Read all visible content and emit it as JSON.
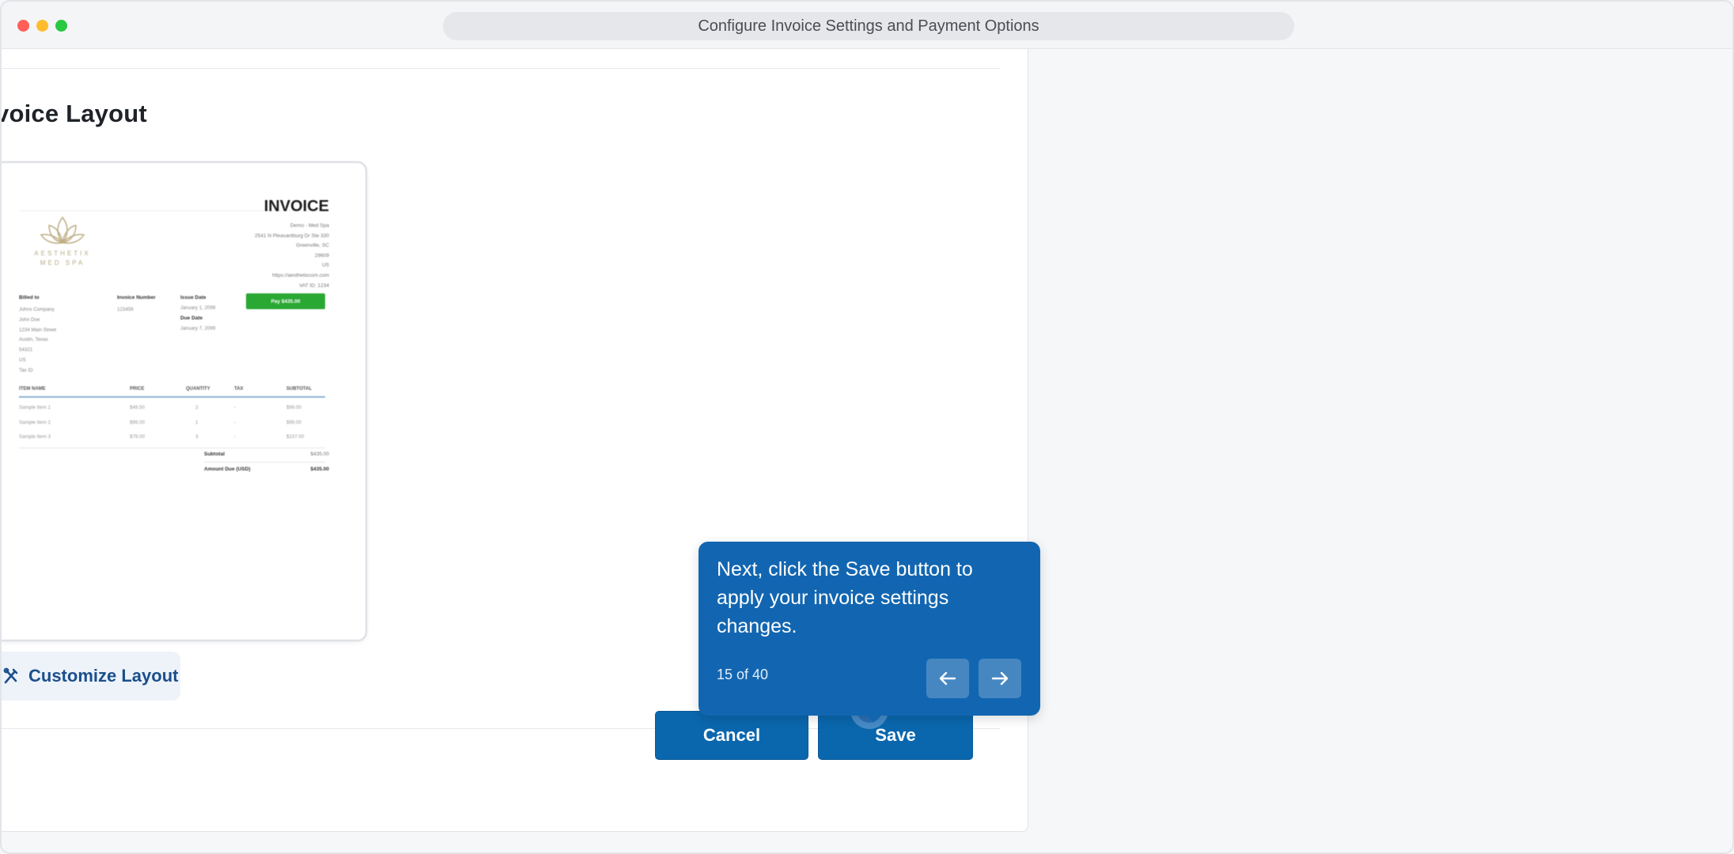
{
  "window": {
    "title": "Configure Invoice Settings and Payment Options"
  },
  "section": {
    "title": "voice Layout"
  },
  "invoice": {
    "title": "INVOICE",
    "address": [
      "Demo - Med Spa",
      "2541 N Pleasantburg Dr Ste 330",
      "Greenville, SC",
      "29609",
      "US",
      "https://aesthetixcom.com",
      "VAT ID: 1234"
    ],
    "logo_line1": "AESTHETIX",
    "logo_line2": "MED SPA",
    "billed_to_label": "Billed to",
    "billed_to_lines": [
      "Johns Company",
      "John Doe",
      "1234 Main Street",
      "Austin, Texas",
      "54321",
      "US",
      "Tax ID"
    ],
    "invoice_number_label": "Invoice Number",
    "invoice_number": "123456",
    "issue_date_label": "Issue Date",
    "issue_date": "January 1, 2099",
    "due_date_label": "Due Date",
    "due_date": "January 7, 2099",
    "pay_button": "Pay $435.00",
    "columns": [
      "ITEM NAME",
      "PRICE",
      "QUANTITY",
      "TAX",
      "SUBTOTAL"
    ],
    "rows": [
      [
        "Sample Item 1",
        "$49.50",
        "2",
        "-",
        "$99.00"
      ],
      [
        "Sample Item 2",
        "$99.00",
        "1",
        "-",
        "$99.00"
      ],
      [
        "Sample Item 3",
        "$79.00",
        "3",
        "-",
        "$237.00"
      ]
    ],
    "subtotal_label": "Subtotal",
    "subtotal_value": "$435.00",
    "amount_due_label": "Amount Due (USD)",
    "amount_due_value": "$435.00"
  },
  "customize": {
    "label": "Customize Layout"
  },
  "actions": {
    "cancel": "Cancel",
    "save": "Save"
  },
  "tooltip": {
    "text": "Next, click the Save button to apply your invoice settings changes.",
    "step": "15 of 40"
  }
}
